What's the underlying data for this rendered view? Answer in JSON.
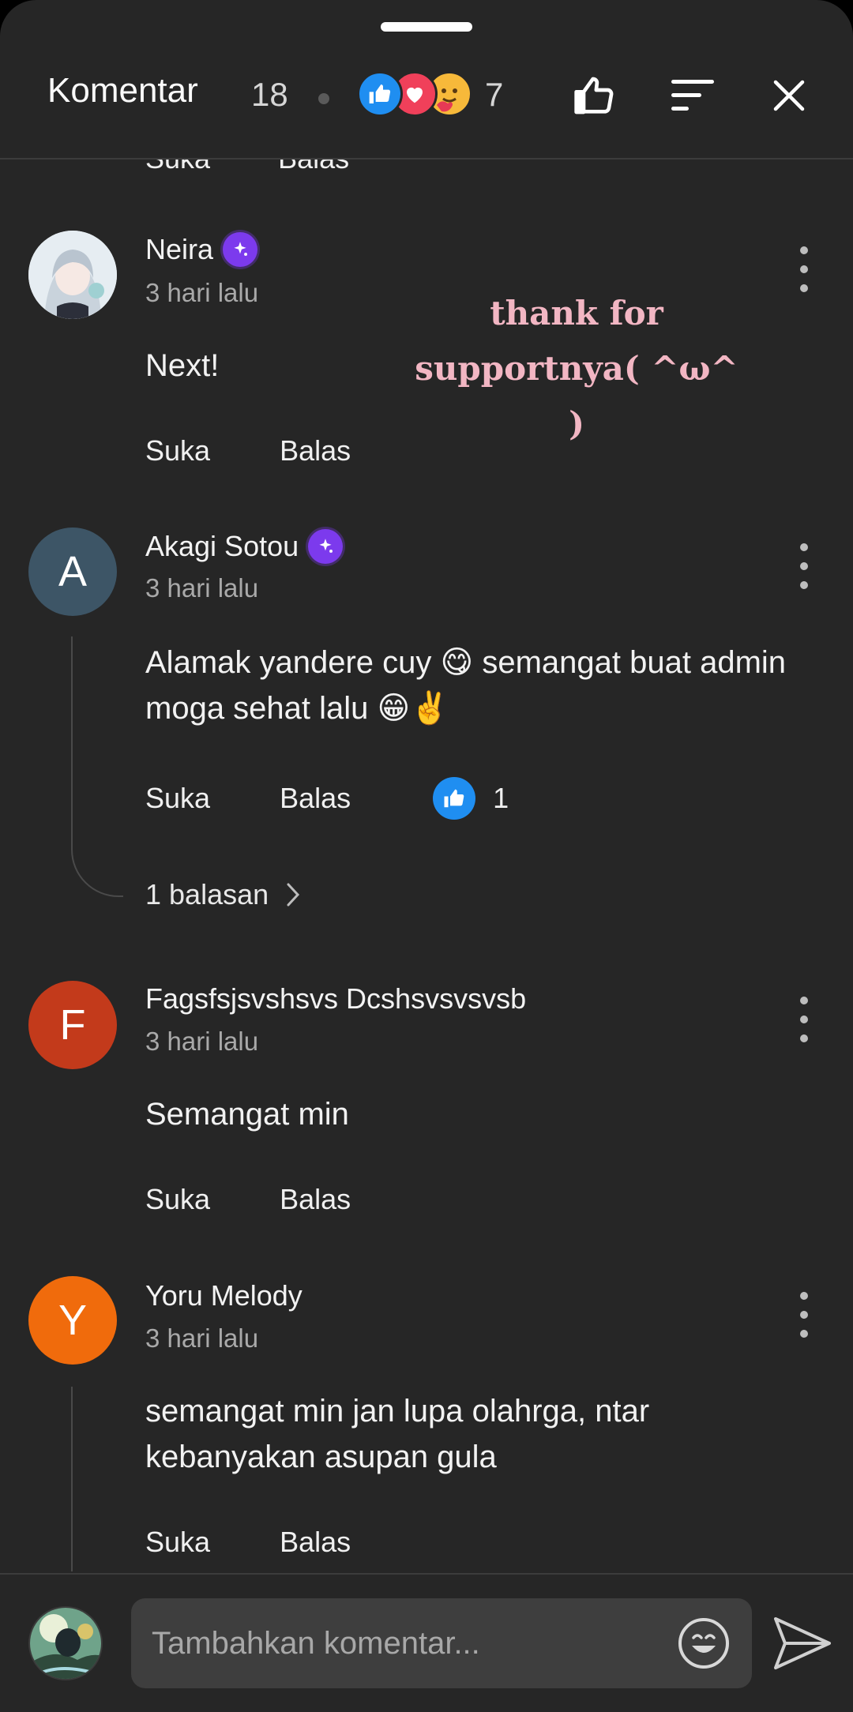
{
  "header": {
    "title": "Komentar",
    "comment_count": "18",
    "reaction_count": "7",
    "reactions": [
      "like-icon",
      "love-icon",
      "care-icon"
    ],
    "buttons": [
      "thumbs-up-icon",
      "sort-icon",
      "close-icon"
    ]
  },
  "labels": {
    "like": "Suka",
    "reply": "Balas"
  },
  "overlay": {
    "line1": "thank for",
    "line2": "supportnya( ^ω^ )"
  },
  "comments": [
    {
      "name": "Neira",
      "verified": true,
      "time": "3 hari lalu",
      "text": "Next!",
      "avatar_letter": "",
      "avatar_color": "#dfe7ee"
    },
    {
      "name": "Akagi Sotou",
      "verified": true,
      "time": "3 hari lalu",
      "text": "Alamak yandere cuy 😋 semangat buat admin moga sehat lalu 😁✌️",
      "avatar_letter": "A",
      "avatar_color": "#3d5566",
      "like_count": "1",
      "replies": "1 balasan"
    },
    {
      "name": "Fagsfsjsvshsvs Dcshsvsvsvsb",
      "verified": false,
      "time": "3 hari lalu",
      "text": "Semangat min",
      "avatar_letter": "F",
      "avatar_color": "#c33a1b"
    },
    {
      "name": "Yoru Melody",
      "verified": false,
      "time": "3 hari lalu",
      "text": "semangat min jan lupa olahrga, ntar kebanyakan asupan gula",
      "avatar_letter": "Y",
      "avatar_color": "#f06b0c"
    }
  ],
  "footer": {
    "placeholder": "Tambahkan komentar..."
  },
  "colors": {
    "background": "#262626",
    "accent_like": "#1f8ef1",
    "verified_badge": "#7c3aed"
  }
}
